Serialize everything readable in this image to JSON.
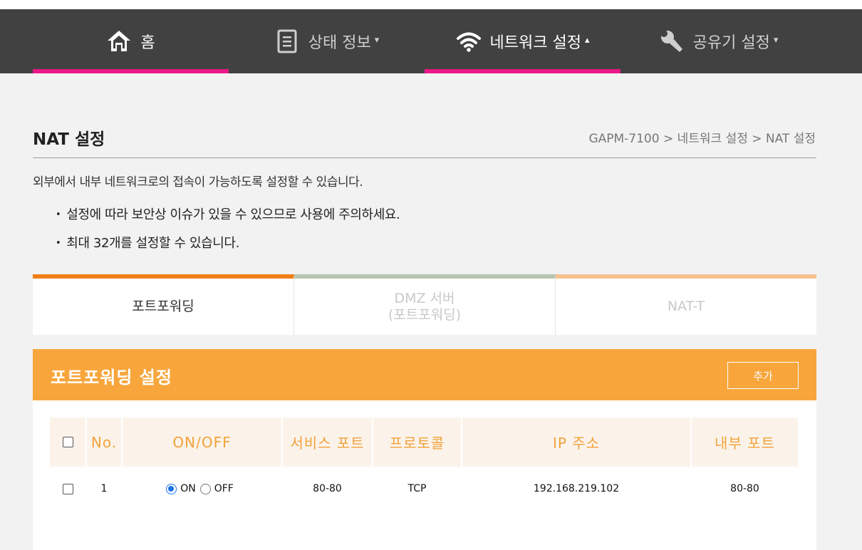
{
  "nav": {
    "items": [
      {
        "label": "홈",
        "icon": "home-icon",
        "caret": "",
        "active": true
      },
      {
        "label": "상태 정보",
        "icon": "document-icon",
        "caret": "▾",
        "active": false
      },
      {
        "label": "네트워크 설정",
        "icon": "wifi-icon",
        "caret": "▴",
        "active": true
      },
      {
        "label": "공유기 설정",
        "icon": "wrench-icon",
        "caret": "▾",
        "active": false
      }
    ],
    "accent_color": "#ec1887"
  },
  "page": {
    "title": "NAT 설정",
    "breadcrumb": "GAPM-7100 > 네트워크 설정 > NAT 설정",
    "description": "외부에서 내부 네트워크로의 접속이 가능하도록 설정할 수 있습니다.",
    "notes": [
      "설정에 따라 보안상 이슈가 있을 수 있으므로 사용에 주의하세요.",
      "최대 32개를 설정할 수 있습니다."
    ]
  },
  "tabs": [
    {
      "line1": "포트포워딩",
      "line2": "",
      "selected": true
    },
    {
      "line1": "DMZ 서버",
      "line2": "(포트포워딩)",
      "selected": false
    },
    {
      "line1": "NAT-T",
      "line2": "",
      "selected": false
    }
  ],
  "panel": {
    "title": "포트포워딩 설정",
    "add_label": "추가",
    "header_color": "#f8a63c"
  },
  "table": {
    "headers": [
      "No.",
      "ON/OFF",
      "서비스 포트",
      "프로토콜",
      "IP 주소",
      "내부 포트"
    ],
    "rows": [
      {
        "no": "1",
        "on_label": "ON",
        "off_label": "OFF",
        "state": "on",
        "service_port": "80-80",
        "protocol": "TCP",
        "ip": "192.168.219.102",
        "internal_port": "80-80"
      }
    ]
  }
}
